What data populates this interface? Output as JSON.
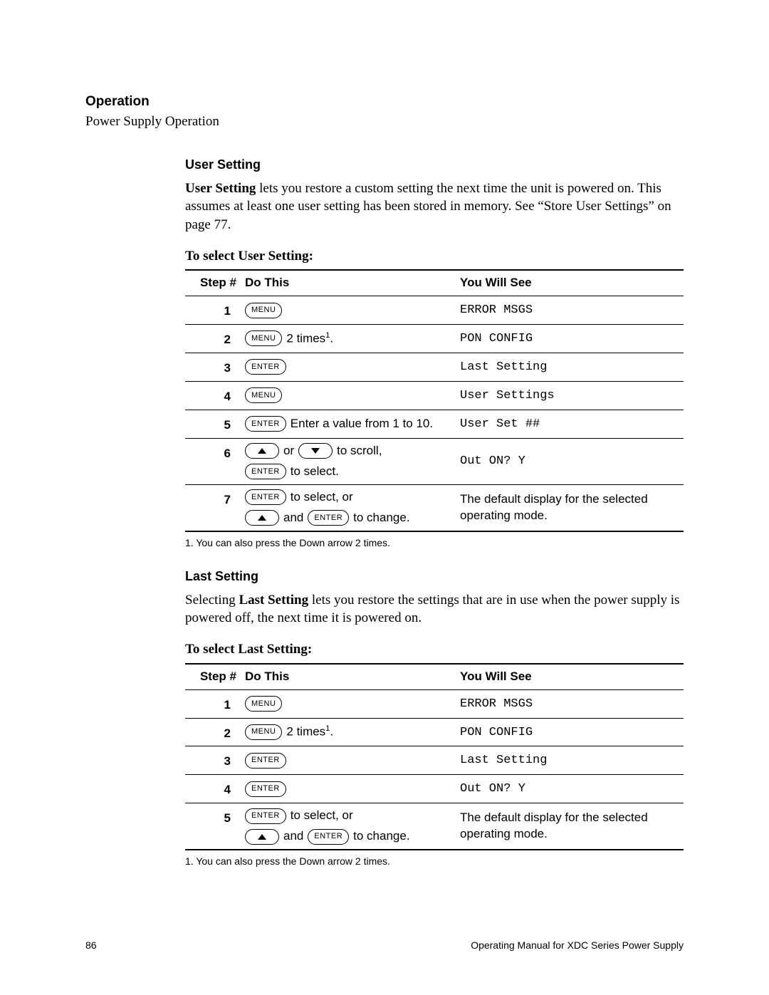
{
  "header": {
    "chapter": "Operation",
    "sub": "Power Supply Operation"
  },
  "buttons": {
    "menu": "MENU",
    "enter": "ENTER"
  },
  "user_setting": {
    "heading": "User Setting",
    "intro_bold": "User Setting",
    "intro_rest": " lets you restore a custom setting the next time the unit is powered on. This assumes at least one user setting has been stored in memory. See “Store User Settings” on page 77.",
    "select_heading": "To select User Setting:",
    "table_headers": {
      "step": "Step #",
      "do": "Do This",
      "see": "You Will See"
    },
    "rows": [
      {
        "n": "1",
        "see": "ERROR MSGS"
      },
      {
        "n": "2",
        "after_btn": " 2 times",
        "sup": "1",
        "dot": ".",
        "see": "PON CONFIG"
      },
      {
        "n": "3",
        "see": "Last Setting"
      },
      {
        "n": "4",
        "see": "User Settings"
      },
      {
        "n": "5",
        "after_btn": " Enter a value from 1 to 10.",
        "see": "User Set ##"
      },
      {
        "n": "6",
        "mid": " or ",
        "tail": " to scroll,",
        "line2_tail": " to select.",
        "see": "Out ON? Y"
      },
      {
        "n": "7",
        "tail": " to select, or",
        "line2_mid": " and ",
        "line2_tail": " to change.",
        "see_plain": "The default display for the selected operating mode."
      }
    ],
    "footnote": "1.  You can also press the Down arrow 2 times."
  },
  "last_setting": {
    "heading": "Last Setting",
    "intro_pre": "Selecting ",
    "intro_bold": "Last Setting",
    "intro_rest": " lets you restore the settings that are in use when the power supply is powered off, the next time it is powered on.",
    "select_heading": "To select Last Setting:",
    "table_headers": {
      "step": "Step #",
      "do": "Do This",
      "see": "You Will See"
    },
    "rows": [
      {
        "n": "1",
        "see": "ERROR MSGS"
      },
      {
        "n": "2",
        "after_btn": " 2 times",
        "sup": "1",
        "dot": ".",
        "see": "PON CONFIG"
      },
      {
        "n": "3",
        "see": "Last Setting"
      },
      {
        "n": "4",
        "see": "Out ON? Y"
      },
      {
        "n": "5",
        "tail": " to select, or",
        "line2_mid": " and ",
        "line2_tail": " to change.",
        "see_plain": "The default display for the selected operating mode."
      }
    ],
    "footnote": "1.  You can also press the Down arrow 2 times."
  },
  "footer": {
    "page": "86",
    "title": "Operating Manual for XDC Series Power Supply"
  }
}
